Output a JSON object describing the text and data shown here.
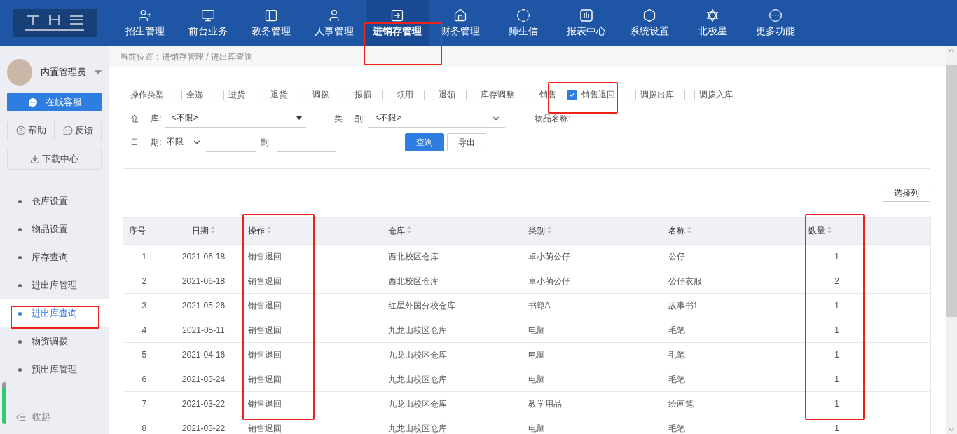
{
  "header": {
    "nav": [
      {
        "label": "招生管理",
        "selected": false
      },
      {
        "label": "前台业务",
        "selected": false
      },
      {
        "label": "教务管理",
        "selected": false
      },
      {
        "label": "人事管理",
        "selected": false
      },
      {
        "label": "进销存管理",
        "selected": true
      },
      {
        "label": "财务管理",
        "selected": false
      },
      {
        "label": "师生信",
        "selected": false
      },
      {
        "label": "报表中心",
        "selected": false
      },
      {
        "label": "系统设置",
        "selected": false
      },
      {
        "label": "北极星",
        "selected": false
      },
      {
        "label": "更多功能",
        "selected": false
      }
    ]
  },
  "sidebar": {
    "user": "内置管理员",
    "service_button": "在线客服",
    "help_button": "帮助",
    "feedback_button": "反馈",
    "download_button": "下载中心",
    "menu": [
      {
        "label": "仓库设置",
        "selected": false
      },
      {
        "label": "物品设置",
        "selected": false
      },
      {
        "label": "库存查询",
        "selected": false
      },
      {
        "label": "进出库管理",
        "selected": false
      },
      {
        "label": "进出库查询",
        "selected": true
      },
      {
        "label": "物资调拨",
        "selected": false
      },
      {
        "label": "预出库管理",
        "selected": false
      }
    ],
    "collapse": "收起"
  },
  "breadcrumb": "当前位置：进销存管理 / 进出库查询",
  "filters": {
    "type_label": "操作类型:",
    "types": [
      {
        "label": "全选",
        "checked": false
      },
      {
        "label": "进货",
        "checked": false
      },
      {
        "label": "退货",
        "checked": false
      },
      {
        "label": "调拨",
        "checked": false
      },
      {
        "label": "报损",
        "checked": false
      },
      {
        "label": "领用",
        "checked": false
      },
      {
        "label": "退领",
        "checked": false
      },
      {
        "label": "库存调整",
        "checked": false
      },
      {
        "label": "销售",
        "checked": false
      },
      {
        "label": "销售退回",
        "checked": true
      },
      {
        "label": "调拨出库",
        "checked": false
      },
      {
        "label": "调拨入库",
        "checked": false
      }
    ],
    "warehouse_label": "仓 库:",
    "warehouse_value": "<不限>",
    "category_label": "类 别:",
    "category_value": "<不限>",
    "item_name_label": "物品名称:",
    "date_label": "日 期:",
    "date_value": "不限",
    "date_to": "到",
    "search_button": "查询",
    "export_button": "导出"
  },
  "columns_button": "选择列",
  "table": {
    "columns": [
      "序号",
      "日期",
      "操作",
      "仓库",
      "类别",
      "名称",
      "数量"
    ],
    "rows": [
      [
        "1",
        "2021-06-18",
        "销售退回",
        "西北校区仓库",
        "卓小萌公仔",
        "公仔",
        "1"
      ],
      [
        "2",
        "2021-06-18",
        "销售退回",
        "西北校区仓库",
        "卓小萌公仔",
        "公仔衣服",
        "2"
      ],
      [
        "3",
        "2021-05-26",
        "销售退回",
        "红星外国分校仓库",
        "书籍A",
        "故事书1",
        "1"
      ],
      [
        "4",
        "2021-05-11",
        "销售退回",
        "九龙山校区仓库",
        "电脑",
        "毛笔",
        "1"
      ],
      [
        "5",
        "2021-04-16",
        "销售退回",
        "九龙山校区仓库",
        "电脑",
        "毛笔",
        "1"
      ],
      [
        "6",
        "2021-03-24",
        "销售退回",
        "九龙山校区仓库",
        "电脑",
        "毛笔",
        "1"
      ],
      [
        "7",
        "2021-03-22",
        "销售退回",
        "九龙山校区仓库",
        "教学用品",
        "绘画笔",
        "1"
      ],
      [
        "8",
        "2021-03-22",
        "销售退回",
        "九龙山校区仓库",
        "电脑",
        "毛笔",
        "1"
      ]
    ]
  }
}
